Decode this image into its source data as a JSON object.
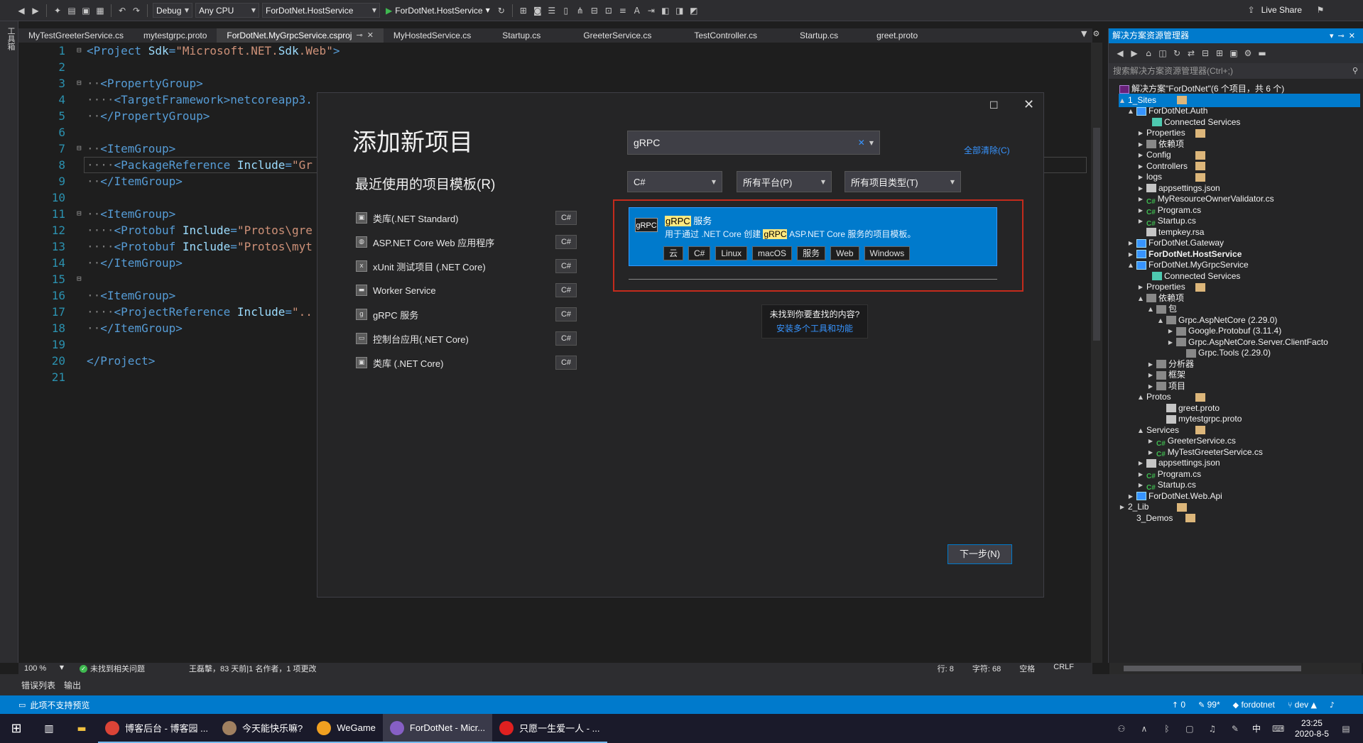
{
  "toolbar": {
    "config": "Debug",
    "platform": "Any CPU",
    "startup_project": "ForDotNet.HostService",
    "run_label": "ForDotNet.HostService",
    "live_share": "Live Share"
  },
  "left_toolbox": "工具箱",
  "tabs": [
    {
      "label": "MyTestGreeterService.cs"
    },
    {
      "label": "mytestgrpc.proto"
    },
    {
      "label": "ForDotNet.MyGrpcService.csproj"
    },
    {
      "label": "MyHostedService.cs"
    },
    {
      "label": "Startup.cs"
    },
    {
      "label": "GreeterService.cs"
    },
    {
      "label": "TestController.cs"
    },
    {
      "label": "Startup.cs"
    },
    {
      "label": "greet.proto"
    }
  ],
  "editor": {
    "line_numbers": [
      "1",
      "2",
      "3",
      "4",
      "5",
      "6",
      "7",
      "8",
      "9",
      "10",
      "11",
      "12",
      "13",
      "14",
      "15",
      "16",
      "17",
      "18",
      "19",
      "20",
      "21"
    ],
    "lines": [
      "<Project Sdk=\"Microsoft.NET.Sdk.Web\">",
      "",
      "  <PropertyGroup>",
      "    <TargetFramework>netcoreapp3.",
      "  </PropertyGroup>",
      "",
      "  <ItemGroup>",
      "    <PackageReference Include=\"Gr",
      "  </ItemGroup>",
      "",
      "  <ItemGroup>",
      "    <Protobuf Include=\"Protos\\gre",
      "    <Protobuf Include=\"Protos\\myt",
      "  </ItemGroup>",
      "",
      "  <ItemGroup>",
      "    <ProjectReference Include=\"..",
      "  </ItemGroup>",
      "",
      "</Project>",
      ""
    ]
  },
  "dialog": {
    "title": "添加新项目",
    "recent_heading": "最近使用的项目模板(R)",
    "recent": [
      {
        "label": "类库(.NET Standard)",
        "lang": "C#"
      },
      {
        "label": "ASP.NET Core Web 应用程序",
        "lang": "C#"
      },
      {
        "label": "xUnit 测试项目 (.NET Core)",
        "lang": "C#"
      },
      {
        "label": "Worker Service",
        "lang": "C#"
      },
      {
        "label": "gRPC 服务",
        "lang": "C#"
      },
      {
        "label": "控制台应用(.NET Core)",
        "lang": "C#"
      },
      {
        "label": "类库 (.NET Core)",
        "lang": "C#"
      }
    ],
    "search_value": "gRPC",
    "clear_all": "全部清除(C)",
    "filters": {
      "language": "C#",
      "platform": "所有平台(P)",
      "project_type": "所有项目类型(T)"
    },
    "result": {
      "icon_text": "gRPC",
      "name_hl": "gRPC",
      "name_rest": " 服务",
      "desc_pre": "用于通过 .NET Core 创建 ",
      "desc_hl": "gRPC",
      "desc_post": " ASP.NET Core 服务的项目模板。",
      "tags": [
        "云",
        "C#",
        "Linux",
        "macOS",
        "服务",
        "Web",
        "Windows"
      ]
    },
    "not_found_q": "未找到你要查找的内容?",
    "not_found_link": "安装多个工具和功能",
    "next_button": "下一步(N)"
  },
  "solution_explorer": {
    "title": "解决方案资源管理器",
    "search_placeholder": "搜索解决方案资源管理器(Ctrl+;)",
    "nodes": [
      {
        "label": "解决方案\"ForDotNet\"(6 个项目，共 6 个)",
        "icon": "sln",
        "arrow": ""
      },
      {
        "label": "1_Sites",
        "icon": "fold",
        "arrow": "▲"
      },
      {
        "label": "ForDotNet.Auth",
        "icon": "proj",
        "arrow": "▲"
      },
      {
        "label": "Connected Services",
        "icon": "conn",
        "arrow": ""
      },
      {
        "label": "Properties",
        "icon": "fold",
        "arrow": "▶"
      },
      {
        "label": "依赖项",
        "icon": "ref",
        "arrow": "▶"
      },
      {
        "label": "Config",
        "icon": "fold",
        "arrow": "▶"
      },
      {
        "label": "Controllers",
        "icon": "fold",
        "arrow": "▶"
      },
      {
        "label": "logs",
        "icon": "fold",
        "arrow": "▶"
      },
      {
        "label": "appsettings.json",
        "icon": "file",
        "arrow": "▶"
      },
      {
        "label": "MyResourceOwnerValidator.cs",
        "icon": "cs",
        "arrow": "▶"
      },
      {
        "label": "Program.cs",
        "icon": "cs",
        "arrow": "▶"
      },
      {
        "label": "Startup.cs",
        "icon": "cs",
        "arrow": "▶"
      },
      {
        "label": "tempkey.rsa",
        "icon": "file",
        "arrow": ""
      },
      {
        "label": "ForDotNet.Gateway",
        "icon": "proj",
        "arrow": "▶"
      },
      {
        "label": "ForDotNet.HostService",
        "icon": "proj",
        "arrow": "▶"
      },
      {
        "label": "ForDotNet.MyGrpcService",
        "icon": "proj",
        "arrow": "▲"
      },
      {
        "label": "Connected Services",
        "icon": "conn",
        "arrow": ""
      },
      {
        "label": "Properties",
        "icon": "fold",
        "arrow": "▶"
      },
      {
        "label": "依赖项",
        "icon": "ref",
        "arrow": "▲"
      },
      {
        "label": "包",
        "icon": "ref",
        "arrow": "▲"
      },
      {
        "label": "Grpc.AspNetCore (2.29.0)",
        "icon": "ref",
        "arrow": "▲"
      },
      {
        "label": "Google.Protobuf (3.11.4)",
        "icon": "ref",
        "arrow": "▶"
      },
      {
        "label": "Grpc.AspNetCore.Server.ClientFacto",
        "icon": "ref",
        "arrow": "▶"
      },
      {
        "label": "Grpc.Tools (2.29.0)",
        "icon": "ref",
        "arrow": ""
      },
      {
        "label": "分析器",
        "icon": "ref",
        "arrow": "▶"
      },
      {
        "label": "框架",
        "icon": "ref",
        "arrow": "▶"
      },
      {
        "label": "项目",
        "icon": "ref",
        "arrow": "▶"
      },
      {
        "label": "Protos",
        "icon": "fold",
        "arrow": "▲"
      },
      {
        "label": "greet.proto",
        "icon": "file",
        "arrow": ""
      },
      {
        "label": "mytestgrpc.proto",
        "icon": "file",
        "arrow": ""
      },
      {
        "label": "Services",
        "icon": "fold",
        "arrow": "▲"
      },
      {
        "label": "GreeterService.cs",
        "icon": "cs",
        "arrow": "▶"
      },
      {
        "label": "MyTestGreeterService.cs",
        "icon": "cs",
        "arrow": "▶"
      },
      {
        "label": "appsettings.json",
        "icon": "file",
        "arrow": "▶"
      },
      {
        "label": "Program.cs",
        "icon": "cs",
        "arrow": "▶"
      },
      {
        "label": "Startup.cs",
        "icon": "cs",
        "arrow": "▶"
      },
      {
        "label": "ForDotNet.Web.Api",
        "icon": "proj",
        "arrow": "▶"
      },
      {
        "label": "2_Lib",
        "icon": "fold",
        "arrow": "▶"
      },
      {
        "label": "3_Demos",
        "icon": "fold",
        "arrow": ""
      }
    ]
  },
  "editor_status": {
    "zoom": "100 %",
    "issues": "未找到相关问题",
    "blame": "王磊擊，83 天前|1 名作者，1 项更改",
    "line": "行: 8",
    "char": "字符: 68",
    "spaces": "空格",
    "eol": "CRLF"
  },
  "bottom_tabs": [
    "错误列表",
    "输出"
  ],
  "statusbar": {
    "message": "此项不支持预览",
    "up": "0",
    "edits": "99*",
    "repo": "fordotnet",
    "branch": "dev"
  },
  "taskbar": {
    "apps": [
      {
        "label": "博客后台 - 博客园 ...",
        "color": "#db4437"
      },
      {
        "label": "今天能快乐嘛?",
        "color": "#a08060"
      },
      {
        "label": "WeGame",
        "color": "#f0a020"
      },
      {
        "label": "ForDotNet - Micr...",
        "color": "#865fc5"
      },
      {
        "label": "只愿一生爱一人 - ...",
        "color": "#e02020"
      }
    ],
    "ime": "中",
    "time": "23:25",
    "date": "2020-8-5"
  }
}
